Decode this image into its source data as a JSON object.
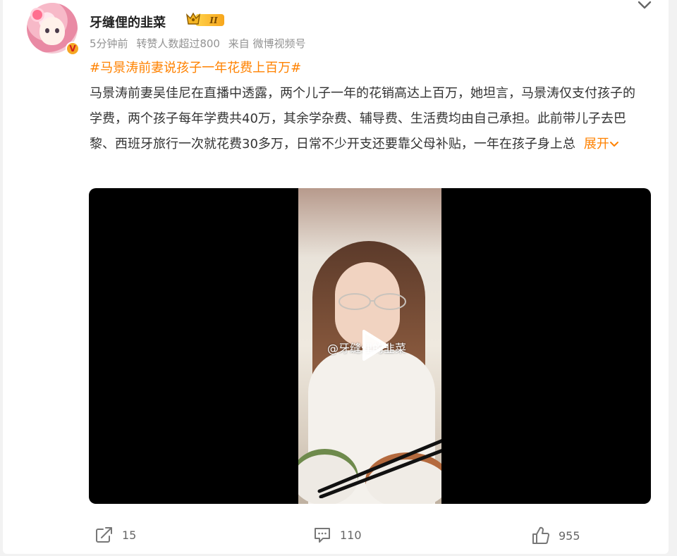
{
  "post": {
    "author": "牙缝俚的韭菜",
    "rank_badge": "II",
    "verify_badge": "V",
    "meta": {
      "time": "5分钟前",
      "reposts_note": "转赞人数超过800",
      "source": "来自 微博视频号"
    },
    "topic": "#马景涛前妻说孩子一年花费上百万#",
    "text": "马景涛前妻吴佳尼在直播中透露，两个儿子一年的花销高达上百万，她坦言，马景涛仅支付孩子的学费，两个孩子每年学费共40万，其余学杂费、辅导费、生活费均由自己承担。此前带儿子去巴黎、西班牙旅行一次就花费30多万，日常不少开支还要靠父母补贴，一年在孩子身上总",
    "expand_label": "展开",
    "video": {
      "watermark": "@牙缝俚的韭菜"
    },
    "actions": {
      "share_count": "15",
      "comment_count": "110",
      "like_count": "955"
    }
  },
  "colors": {
    "accent": "#ff8200",
    "text": "#333333",
    "meta": "#939393",
    "background": "#f2f2f2"
  },
  "icons": [
    "chevron-down-icon",
    "share-icon",
    "comment-icon",
    "like-icon",
    "play-icon",
    "rank-badge-icon",
    "verified-v-icon"
  ]
}
